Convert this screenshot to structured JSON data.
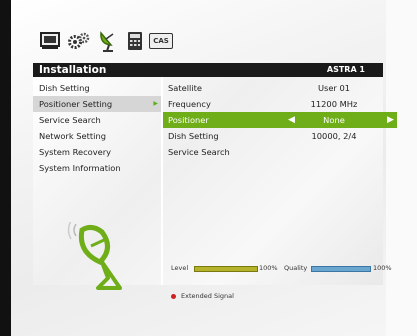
{
  "top_icons": [
    "tv-icon",
    "settings-gears-icon",
    "satellite-dish-icon",
    "calculator-icon",
    "cas-icon"
  ],
  "cas_label": "CAS",
  "header": {
    "title": "Installation",
    "satellite": "ASTRA 1"
  },
  "menu": {
    "items": [
      {
        "label": "Dish Setting"
      },
      {
        "label": "Positioner Setting",
        "selected": true
      },
      {
        "label": "Service Search"
      },
      {
        "label": "Network Setting"
      },
      {
        "label": "System Recovery"
      },
      {
        "label": "System Information"
      }
    ]
  },
  "settings": {
    "rows": [
      {
        "label": "Satellite",
        "value": "User 01"
      },
      {
        "label": "Frequency",
        "value": "11200 MHz"
      },
      {
        "label": "Positioner",
        "value": "None",
        "highlighted": true
      },
      {
        "label": "Dish Setting",
        "value": "10000, 2/4"
      },
      {
        "label": "Service Search",
        "value": ""
      }
    ]
  },
  "signal": {
    "level_label": "Level",
    "level_value": "100%",
    "level_fraction": 1.0,
    "quality_label": "Quality",
    "quality_value": "100%",
    "quality_fraction": 1.0
  },
  "extended_signal": "Extended Signal",
  "colors": {
    "highlight": "#6fae19",
    "header": "#1a1a1a",
    "level_bar": "#b5b32a",
    "quality_bar": "#6aa6d0"
  }
}
